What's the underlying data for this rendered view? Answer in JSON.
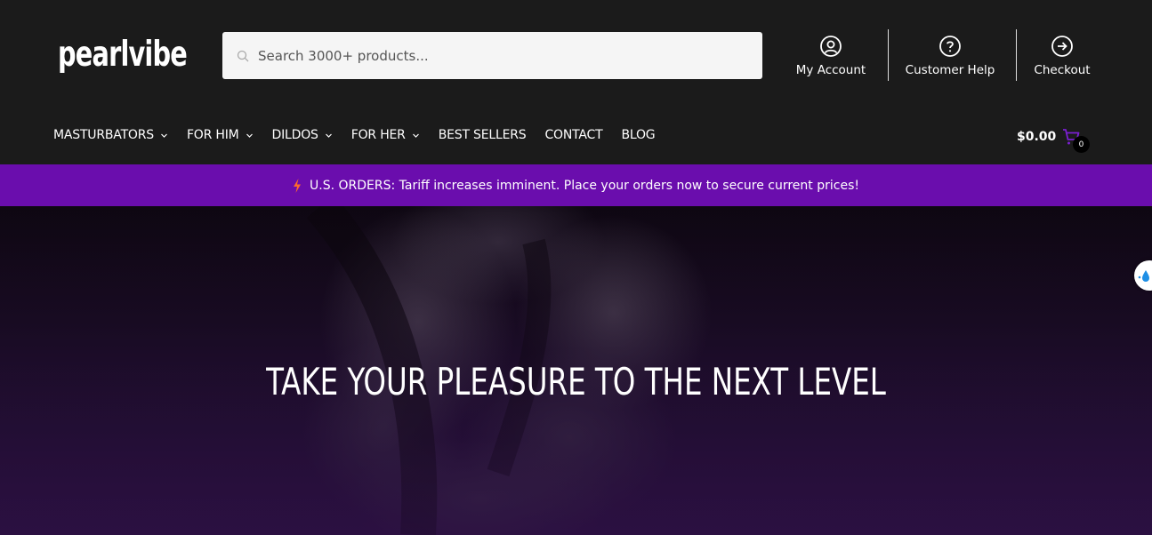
{
  "header": {
    "logo_text": "pearlvibe",
    "search": {
      "placeholder": "Search 3000+ products..."
    },
    "account_links": [
      {
        "label": "My Account",
        "icon": "user-circle-icon"
      },
      {
        "label": "Customer Help",
        "icon": "question-circle-icon"
      },
      {
        "label": "Checkout",
        "icon": "arrow-right-circle-icon"
      }
    ]
  },
  "nav": {
    "items": [
      {
        "label": "MASTURBATORS",
        "has_dropdown": true
      },
      {
        "label": "FOR HIM",
        "has_dropdown": true
      },
      {
        "label": "DILDOS",
        "has_dropdown": true
      },
      {
        "label": "FOR HER",
        "has_dropdown": true
      },
      {
        "label": "BEST SELLERS",
        "has_dropdown": false
      },
      {
        "label": "CONTACT",
        "has_dropdown": false
      },
      {
        "label": "BLOG",
        "has_dropdown": false
      }
    ],
    "cart": {
      "total": "$0.00",
      "count": "0"
    }
  },
  "banner": {
    "text": "U.S. ORDERS: Tariff increases imminent. Place your orders now to secure current prices!",
    "icon": "lightning-bolt-icon"
  },
  "hero": {
    "title": "TAKE YOUR PLEASURE TO THE NEXT LEVEL"
  },
  "colors": {
    "header_bg": "#1b1b1b",
    "banner_bg": "#6a0dad",
    "accent": "#7b1fd1",
    "bolt": "#ff6a2a"
  }
}
